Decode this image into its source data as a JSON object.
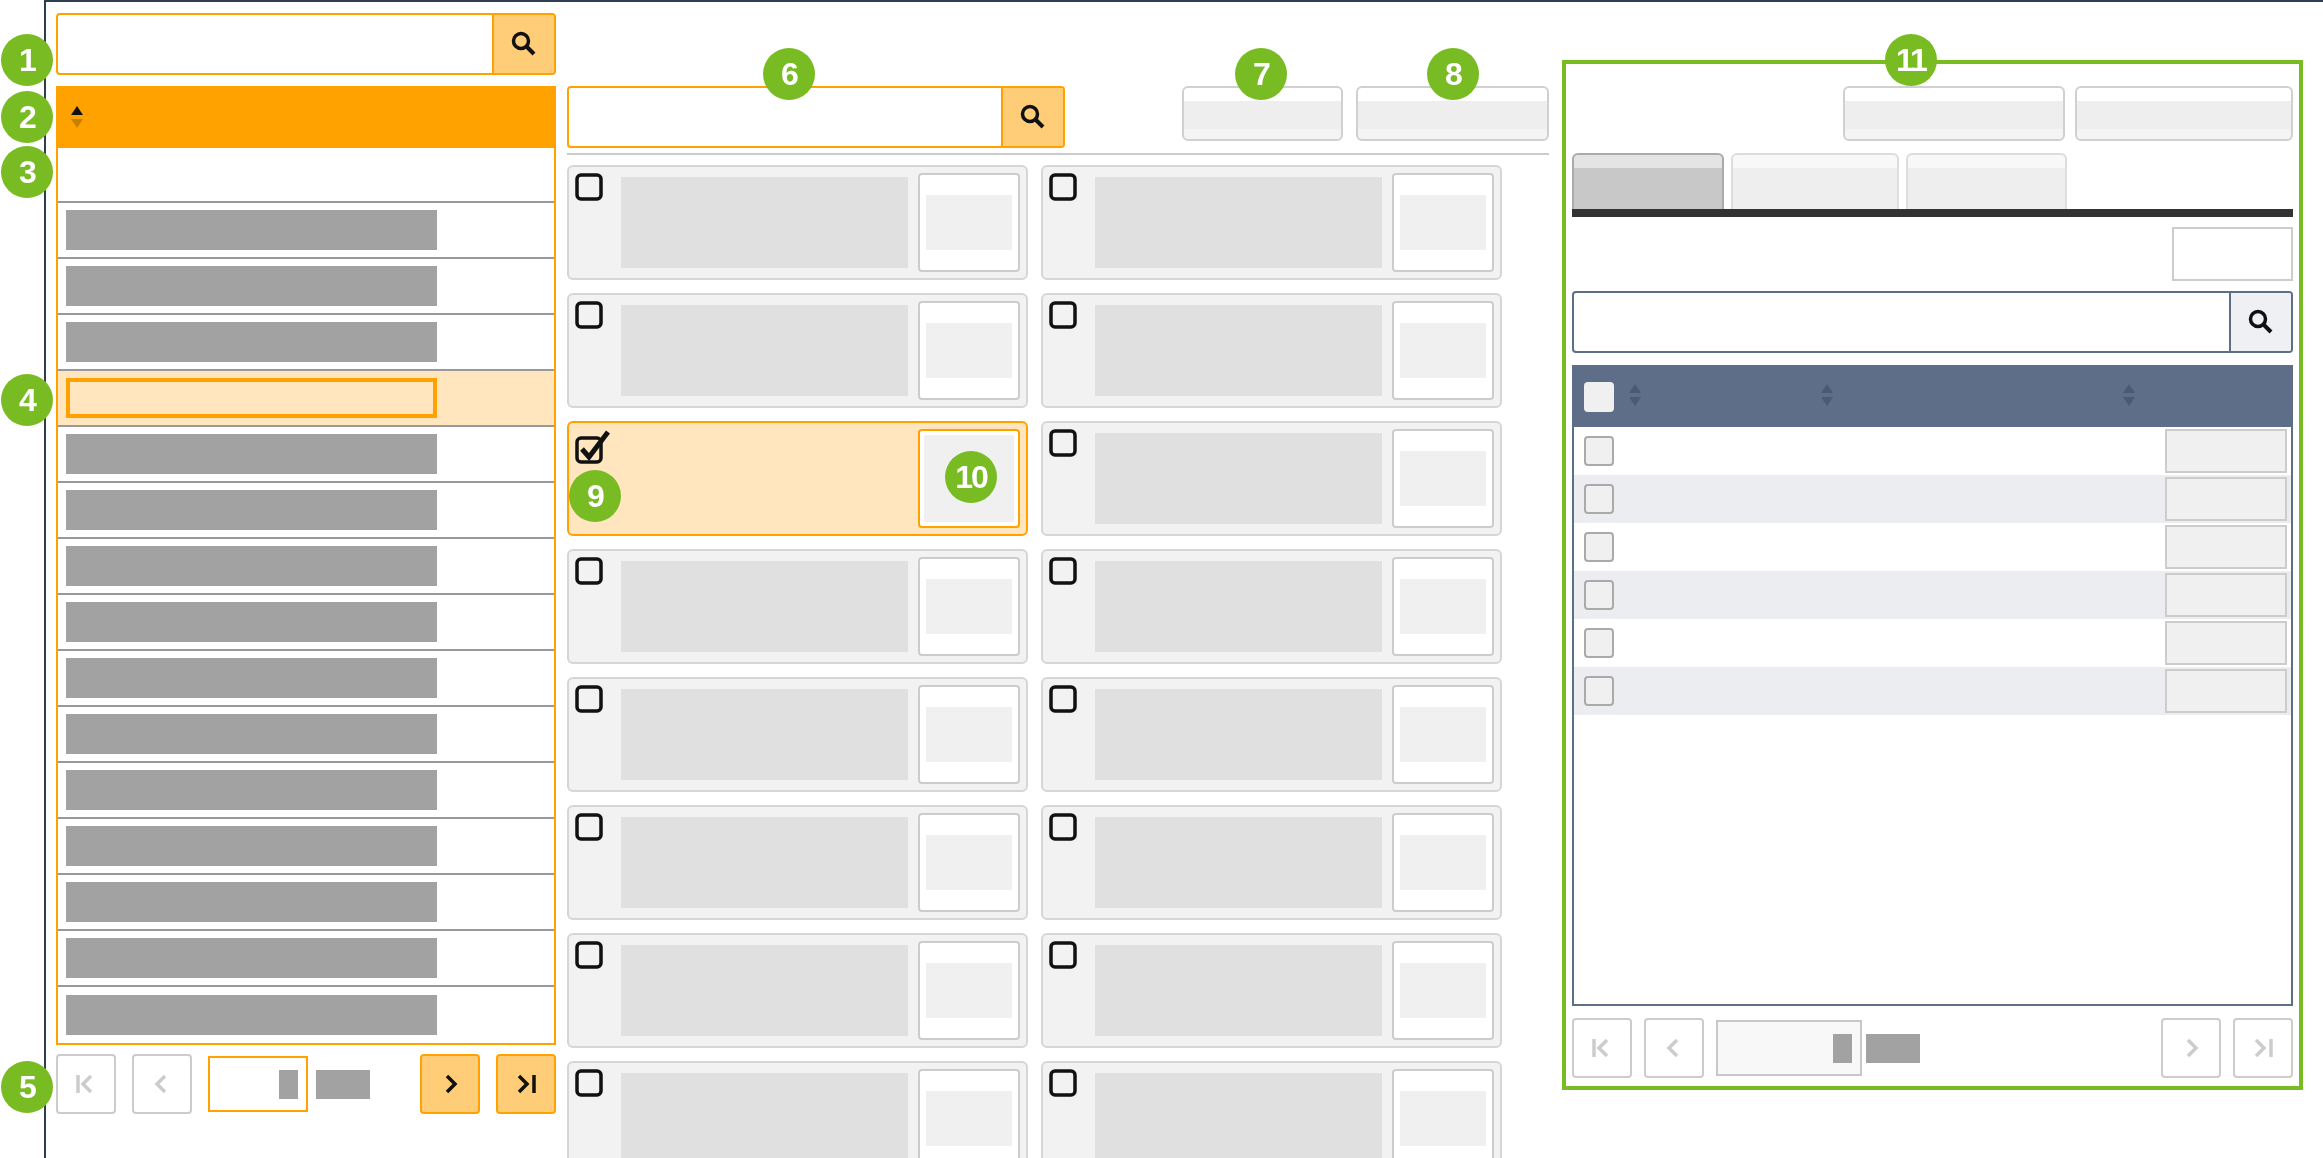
{
  "left_panel": {
    "search_callout": "1",
    "header": {
      "callout": "2",
      "sorted_ascending": true
    },
    "filter_row_callout": "3",
    "rows": [
      {
        "selected": false
      },
      {
        "selected": false
      },
      {
        "selected": false
      },
      {
        "selected": true,
        "callout": "4"
      },
      {
        "selected": false
      },
      {
        "selected": false
      },
      {
        "selected": false
      },
      {
        "selected": false
      },
      {
        "selected": false
      },
      {
        "selected": false
      },
      {
        "selected": false
      },
      {
        "selected": false
      },
      {
        "selected": false
      },
      {
        "selected": false
      },
      {
        "selected": false
      }
    ],
    "pager": {
      "callout": "5",
      "buttons": [
        {
          "kind": "first",
          "disabled": true
        },
        {
          "kind": "previous",
          "disabled": true
        },
        {
          "kind": "next",
          "disabled": false
        },
        {
          "kind": "last",
          "disabled": false
        }
      ]
    }
  },
  "middle_panel": {
    "search_callout": "6",
    "buttons": [
      {
        "callout": "7"
      },
      {
        "callout": "8"
      }
    ],
    "cards": [
      {
        "checked": false
      },
      {
        "checked": false
      },
      {
        "checked": false
      },
      {
        "checked": false
      },
      {
        "checked": true,
        "check_callout": "9",
        "thumbnail_callout": "10"
      },
      {
        "checked": false
      },
      {
        "checked": false
      },
      {
        "checked": false
      },
      {
        "checked": false
      },
      {
        "checked": false
      },
      {
        "checked": false
      },
      {
        "checked": false
      },
      {
        "checked": false
      },
      {
        "checked": false
      },
      {
        "checked": false
      },
      {
        "checked": false
      }
    ]
  },
  "right_panel": {
    "callout": "11",
    "tabs": [
      {
        "selected": true
      },
      {
        "selected": false
      },
      {
        "selected": false
      }
    ],
    "table": {
      "all_checked": false,
      "rows": [
        {
          "checked": false
        },
        {
          "checked": false
        },
        {
          "checked": false
        },
        {
          "checked": false
        },
        {
          "checked": false
        },
        {
          "checked": false
        }
      ]
    },
    "pager": {
      "buttons": [
        {
          "kind": "first",
          "disabled": true
        },
        {
          "kind": "previous",
          "disabled": true
        },
        {
          "kind": "next",
          "disabled": true
        },
        {
          "kind": "last",
          "disabled": true
        }
      ]
    }
  }
}
